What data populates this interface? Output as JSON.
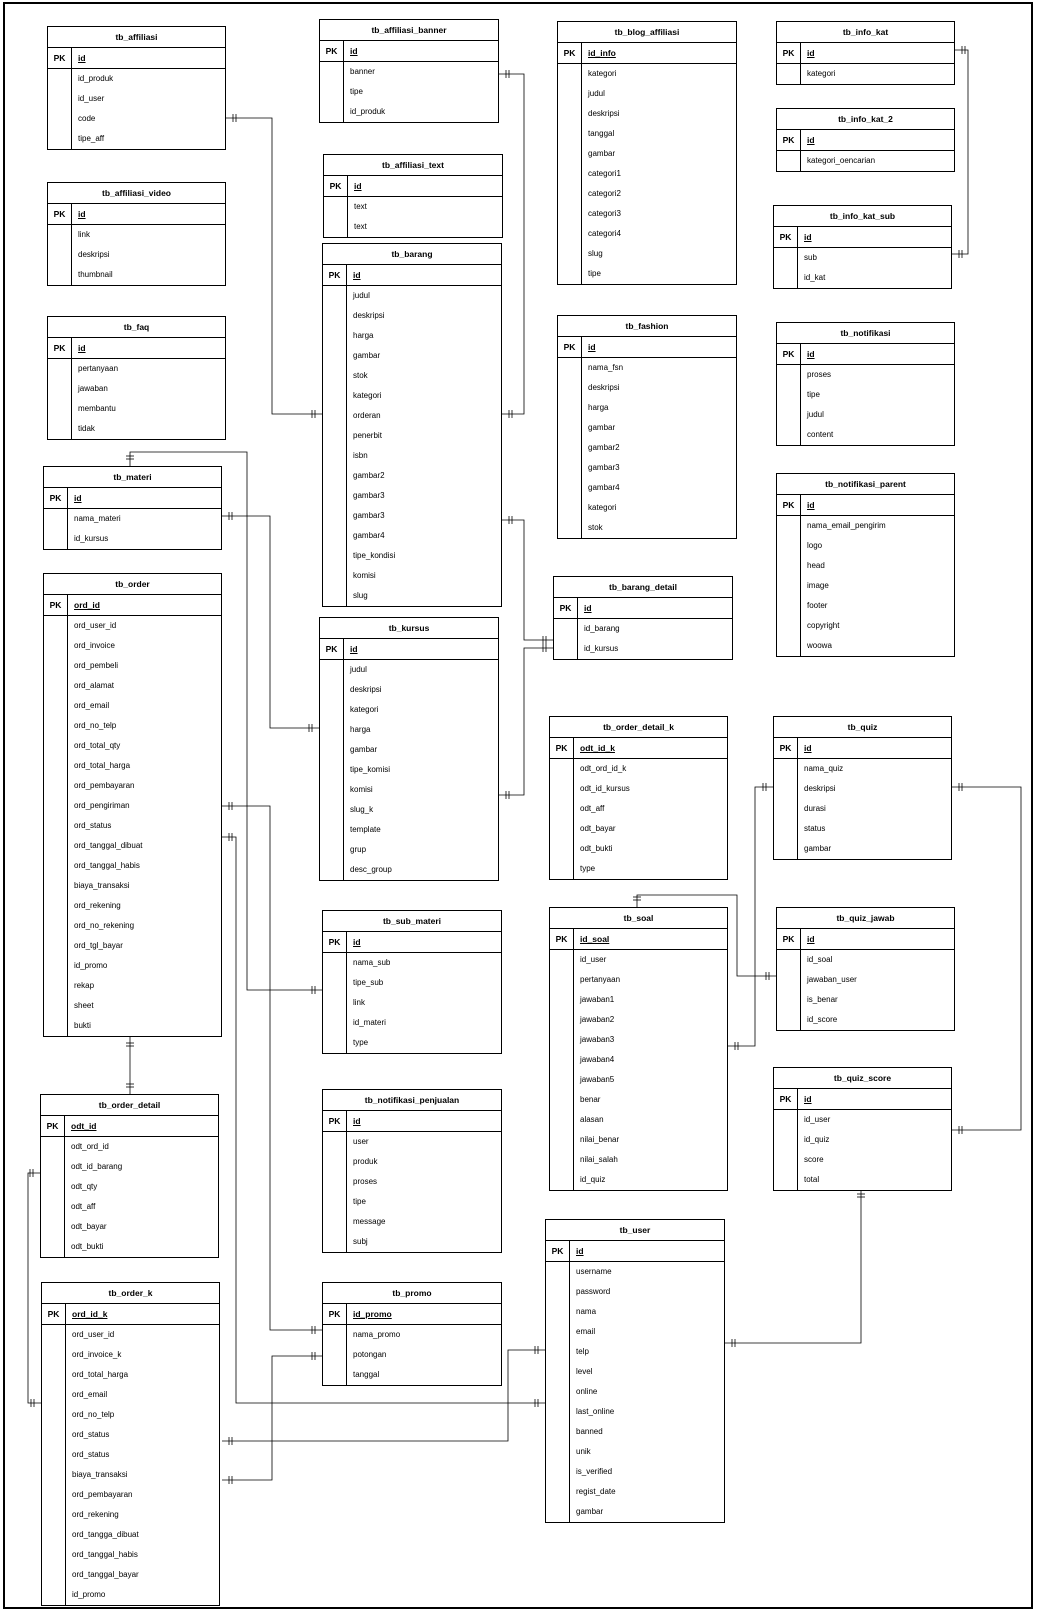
{
  "tables": [
    {
      "name": "tb_affiliasi",
      "pk_label": "PK",
      "pk": "id",
      "fields": [
        "id_produk",
        "id_user",
        "code",
        "tipe_aff"
      ]
    },
    {
      "name": "tb_affiliasi_video",
      "pk_label": "PK",
      "pk": "id",
      "fields": [
        "link",
        "deskripsi",
        "thumbnail"
      ]
    },
    {
      "name": "tb_faq",
      "pk_label": "PK",
      "pk": "id",
      "fields": [
        "pertanyaan",
        "jawaban",
        "membantu",
        "tidak"
      ]
    },
    {
      "name": "tb_materi",
      "pk_label": "PK",
      "pk": "id",
      "fields": [
        "nama_materi",
        "id_kursus"
      ]
    },
    {
      "name": "tb_order",
      "pk_label": "PK",
      "pk": "ord_id",
      "fields": [
        "ord_user_id",
        "ord_invoice",
        "ord_pembeli",
        "ord_alamat",
        "ord_email",
        "ord_no_telp",
        "ord_total_qty",
        "ord_total_harga",
        "ord_pembayaran",
        "ord_pengiriman",
        "ord_status",
        "ord_tanggal_dibuat",
        "ord_tanggal_habis",
        "biaya_transaksi",
        "ord_rekening",
        "ord_no_rekening",
        "ord_tgl_bayar",
        "id_promo",
        "rekap",
        "sheet",
        "bukti"
      ]
    },
    {
      "name": "tb_order_detail",
      "pk_label": "PK",
      "pk": "odt_id",
      "fields": [
        "odt_ord_id",
        "odt_id_barang",
        "odt_qty",
        "odt_aff",
        "odt_bayar",
        "odt_bukti"
      ]
    },
    {
      "name": "tb_order_k",
      "pk_label": "PK",
      "pk": "ord_id_k",
      "fields": [
        "ord_user_id",
        "ord_invoice_k",
        "ord_total_harga",
        "ord_email",
        "ord_no_telp",
        "ord_status",
        "ord_status",
        "biaya_transaksi",
        "ord_pembayaran",
        "ord_rekening",
        "ord_tangga_dibuat",
        "ord_tanggal_habis",
        "ord_tanggal_bayar",
        "id_promo"
      ]
    },
    {
      "name": "tb_affiliasi_banner",
      "pk_label": "PK",
      "pk": "id",
      "fields": [
        "banner",
        "tipe",
        "id_produk"
      ]
    },
    {
      "name": "tb_affiliasi_text",
      "pk_label": "PK",
      "pk": "id",
      "fields": [
        "text",
        "text"
      ]
    },
    {
      "name": "tb_barang",
      "pk_label": "PK",
      "pk": "id",
      "fields": [
        "judul",
        "deskripsi",
        "harga",
        "gambar",
        "stok",
        "kategori",
        "orderan",
        "penerbit",
        "isbn",
        "gambar2",
        "gambar3",
        "gambar3",
        "gambar4",
        "tipe_kondisi",
        "komisi",
        "slug"
      ]
    },
    {
      "name": "tb_kursus",
      "pk_label": "PK",
      "pk": "id",
      "fields": [
        "judul",
        "deskripsi",
        "kategori",
        "harga",
        "gambar",
        "tipe_komisi",
        "komisi",
        "slug_k",
        "template",
        "grup",
        "desc_group"
      ]
    },
    {
      "name": "tb_sub_materi",
      "pk_label": "PK",
      "pk": "id",
      "fields": [
        "nama_sub",
        "tipe_sub",
        "link",
        "id_materi",
        "type"
      ]
    },
    {
      "name": "tb_notifikasi_penjualan",
      "pk_label": "PK",
      "pk": "id",
      "fields": [
        "user",
        "produk",
        "proses",
        "tipe",
        "message",
        "subj"
      ]
    },
    {
      "name": "tb_promo",
      "pk_label": "PK",
      "pk": "id_promo",
      "fields": [
        "nama_promo",
        "potongan",
        "tanggal"
      ]
    },
    {
      "name": "tb_blog_affiliasi",
      "pk_label": "PK",
      "pk": "id_info",
      "fields": [
        "kategori",
        "judul",
        "deskripsi",
        "tanggal",
        "gambar",
        "categori1",
        "categori2",
        "categori3",
        "categori4",
        "slug",
        "tipe"
      ]
    },
    {
      "name": "tb_fashion",
      "pk_label": "PK",
      "pk": "id",
      "fields": [
        "nama_fsn",
        "deskripsi",
        "harga",
        "gambar",
        "gambar2",
        "gambar3",
        "gambar4",
        "kategori",
        "stok"
      ]
    },
    {
      "name": "tb_barang_detail",
      "pk_label": "PK",
      "pk": "id",
      "fields": [
        "id_barang",
        "id_kursus"
      ]
    },
    {
      "name": "tb_order_detail_k",
      "pk_label": "PK",
      "pk": "odt_id_k",
      "fields": [
        "odt_ord_id_k",
        "odt_id_kursus",
        "odt_aff",
        "odt_bayar",
        "odt_bukti",
        "type"
      ]
    },
    {
      "name": "tb_soal",
      "pk_label": "PK",
      "pk": "id_soal",
      "fields": [
        "id_user",
        "pertanyaan",
        "jawaban1",
        "jawaban2",
        "jawaban3",
        "jawaban4",
        "jawaban5",
        "benar",
        "alasan",
        "nilai_benar",
        "nilai_salah",
        "id_quiz"
      ]
    },
    {
      "name": "tb_user",
      "pk_label": "PK",
      "pk": "id",
      "fields": [
        "username",
        "password",
        "nama",
        "email",
        "telp",
        "level",
        "online",
        "last_online",
        "banned",
        "unik",
        "is_verified",
        "regist_date",
        "gambar"
      ]
    },
    {
      "name": "tb_info_kat",
      "pk_label": "PK",
      "pk": "id",
      "fields": [
        "kategori"
      ]
    },
    {
      "name": "tb_info_kat_2",
      "pk_label": "PK",
      "pk": "id",
      "fields": [
        "kategori_oencarian"
      ]
    },
    {
      "name": "tb_info_kat_sub",
      "pk_label": "PK",
      "pk": "id",
      "fields": [
        "sub",
        "id_kat"
      ]
    },
    {
      "name": "tb_notifikasi",
      "pk_label": "PK",
      "pk": "id",
      "fields": [
        "proses",
        "tipe",
        "judul",
        "content"
      ]
    },
    {
      "name": "tb_notifikasi_parent",
      "pk_label": "PK",
      "pk": "id",
      "fields": [
        "nama_email_pengirim",
        "logo",
        "head",
        "image",
        "footer",
        "copyright",
        "woowa"
      ]
    },
    {
      "name": "tb_quiz",
      "pk_label": "PK",
      "pk": "id",
      "fields": [
        "nama_quiz",
        "deskripsi",
        "durasi",
        "status",
        "gambar"
      ]
    },
    {
      "name": "tb_quiz_jawab",
      "pk_label": "PK",
      "pk": "id",
      "fields": [
        "id_soal",
        "jawaban_user",
        "is_benar",
        "id_score"
      ]
    },
    {
      "name": "tb_quiz_score",
      "pk_label": "PK",
      "pk": "id",
      "fields": [
        "id_user",
        "id_quiz",
        "score",
        "total"
      ]
    }
  ]
}
